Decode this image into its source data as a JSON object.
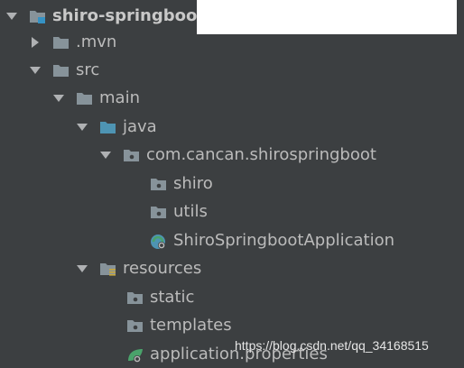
{
  "tree": [
    {
      "label": "shiro-springboot",
      "expanded": true,
      "icon": "module-folder-icon",
      "bold": true
    },
    {
      "label": ".mvn",
      "expanded": false,
      "icon": "folder-icon"
    },
    {
      "label": "src",
      "expanded": true,
      "icon": "folder-icon"
    },
    {
      "label": "main",
      "expanded": true,
      "icon": "folder-icon"
    },
    {
      "label": "java",
      "expanded": true,
      "icon": "source-root-folder-icon"
    },
    {
      "label": "com.cancan.shirospringboot",
      "expanded": true,
      "icon": "package-icon"
    },
    {
      "label": "shiro",
      "icon": "package-icon"
    },
    {
      "label": "utils",
      "icon": "package-icon"
    },
    {
      "label": "ShiroSpringbootApplication",
      "icon": "spring-boot-class-icon"
    },
    {
      "label": "resources",
      "expanded": true,
      "icon": "resources-root-folder-icon"
    },
    {
      "label": "static",
      "icon": "package-icon"
    },
    {
      "label": "templates",
      "icon": "package-icon"
    },
    {
      "label": "application.properties",
      "icon": "spring-properties-icon"
    }
  ],
  "watermark": "https://blog.csdn.net/qq_34168515",
  "colors": {
    "background": "#3c3f41",
    "text": "#bbbbbb",
    "folder": "#87939a",
    "source_folder": "#4e94b3",
    "resources_accent": "#c9a83c",
    "spring": "#4aa36b",
    "module_accent": "#3592c4"
  }
}
